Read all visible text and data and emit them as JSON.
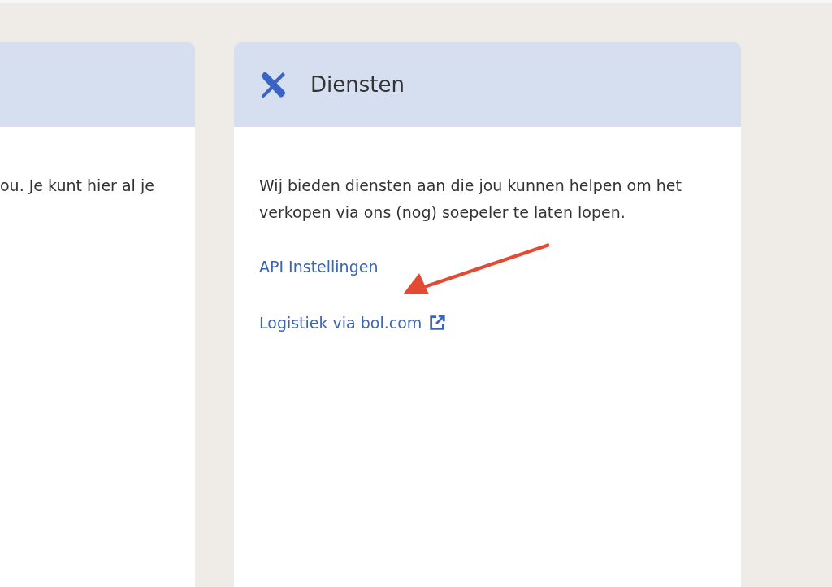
{
  "left_card": {
    "body_text": "ou. Je kunt hier al je"
  },
  "services_card": {
    "title": "Diensten",
    "description": "Wij bieden diensten aan die jou kunnen helpen om het verkopen via ons (nog) soepeler te laten lopen.",
    "links": [
      {
        "label": "API Instellingen",
        "external": false
      },
      {
        "label": "Logistiek via bol.com",
        "external": true
      }
    ]
  }
}
